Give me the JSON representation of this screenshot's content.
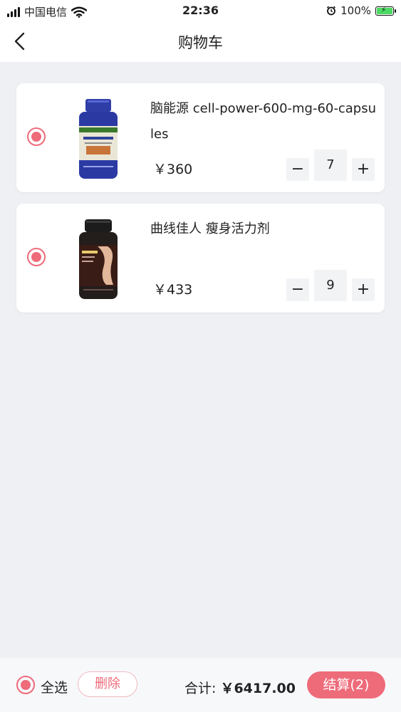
{
  "status_bar": {
    "carrier": "中国电信",
    "time": "22:36",
    "battery_percent": "100%"
  },
  "nav": {
    "title": "购物车"
  },
  "cart": {
    "items": [
      {
        "name": "脑能源 cell-power-600-mg-60-capsules",
        "price": "￥360",
        "quantity": "7",
        "selected": true,
        "image_icon": "blue-supplement-bottle"
      },
      {
        "name": "曲线佳人 瘦身活力剂",
        "price": "￥433",
        "quantity": "9",
        "selected": true,
        "image_icon": "dark-supplement-bottle"
      }
    ]
  },
  "stepper": {
    "minus": "−",
    "plus": "+"
  },
  "bottom_bar": {
    "select_all": "全选",
    "delete": "删除",
    "total_label": "合计:",
    "total_value": "￥6417.00",
    "checkout": "结算(2)"
  },
  "colors": {
    "accent": "#ee6b7a",
    "background": "#eef0f4",
    "card": "#ffffff"
  }
}
